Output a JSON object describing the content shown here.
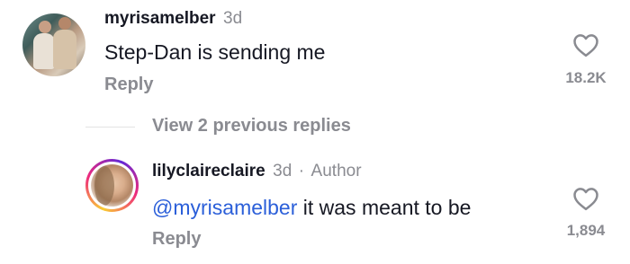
{
  "comments": [
    {
      "username": "myrisamelber",
      "time": "3d",
      "text": "Step-Dan is sending me",
      "reply_label": "Reply",
      "like_count": "18.2K"
    },
    {
      "username": "lilyclaireclaire",
      "time": "3d",
      "separator": "·",
      "badge": "Author",
      "mention": "@myrisamelber",
      "text": " it was meant to be",
      "reply_label": "Reply",
      "like_count": "1,894"
    }
  ],
  "view_previous": "View 2 previous replies",
  "icons": {
    "like": "heart-outline-icon"
  },
  "colors": {
    "mention": "#2b5fd9",
    "muted": "#8a8b91",
    "text": "#161823"
  }
}
